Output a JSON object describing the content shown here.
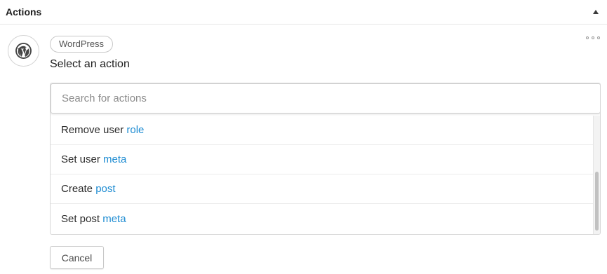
{
  "header": {
    "title": "Actions",
    "toggle_icon": "triangle-up-icon"
  },
  "step": {
    "integration_icon": "wordpress-icon",
    "integration_label": "WordPress",
    "menu_icon": "more-horizontal-icon",
    "title": "Select an action"
  },
  "search": {
    "placeholder": "Search for actions",
    "value": ""
  },
  "options": [
    {
      "label": "Remove user ",
      "token": "role"
    },
    {
      "label": "Set user ",
      "token": "meta"
    },
    {
      "label": "Create ",
      "token": "post"
    },
    {
      "label": "Set post ",
      "token": "meta"
    }
  ],
  "footer": {
    "cancel_label": "Cancel"
  },
  "colors": {
    "token_accent": "#1e8cd2",
    "border": "#d7d7d7"
  }
}
